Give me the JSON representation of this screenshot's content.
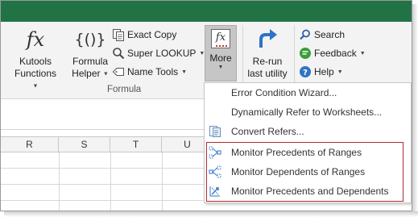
{
  "ribbon": {
    "kutools_functions": {
      "line1": "Kutools",
      "line2": "Functions"
    },
    "formula_helper": {
      "line1": "Formula",
      "line2": "Helper"
    },
    "exact_copy": "Exact Copy",
    "super_lookup": "Super LOOKUP",
    "name_tools": "Name Tools",
    "more": "More",
    "rerun": {
      "line1": "Re-run",
      "line2": "last utility"
    },
    "search": "Search",
    "feedback": "Feedback",
    "help": "Help",
    "group_formula": "Formula",
    "fx_glyph": "fx",
    "formula_helper_glyph": "{()}"
  },
  "grid": {
    "columns": [
      "R",
      "S",
      "T",
      "U"
    ]
  },
  "menu": {
    "items": [
      "Error Condition Wizard...",
      "Dynamically Refer to Worksheets...",
      "Convert Refers...",
      "Monitor Precedents of Ranges",
      "Monitor Dependents of Ranges",
      "Monitor Precedents and Dependents"
    ]
  },
  "colors": {
    "excel_green": "#217346",
    "highlight_red": "#b22a2a",
    "arrow_blue": "#2f73c4"
  }
}
